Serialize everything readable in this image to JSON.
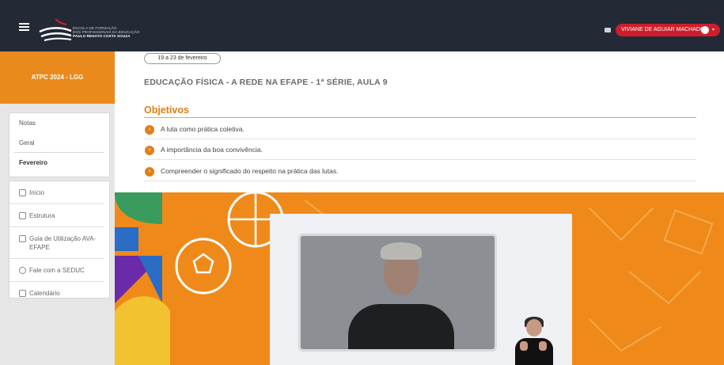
{
  "header": {
    "logo": {
      "line1": "ESCOLA DE FORMAÇÃO",
      "line2": "DOS PROFISSIONAIS DA EDUCAÇÃO",
      "line3": "PAULO RENATO COSTA SOUZA"
    },
    "user_name": "VIVIANE DE AGUIAR MACHADO"
  },
  "sidebar": {
    "course": "ATPC 2024 - LGG",
    "nav1": [
      "Notas",
      "Geral",
      "Fevereiro"
    ],
    "nav2": [
      {
        "label": "Início",
        "icon": "home-icon"
      },
      {
        "label": "Estrutura",
        "icon": "structure-icon"
      },
      {
        "label": "Guia de Utilização AVA-EFAPE",
        "icon": "book-icon"
      },
      {
        "label": "Fale com a SEDUC",
        "icon": "info-icon"
      },
      {
        "label": "Calendário",
        "icon": "calendar-icon"
      }
    ]
  },
  "main": {
    "date_range": "19 a 23 de fevereiro",
    "lesson_title": "EDUCAÇÃO FÍSICA - A REDE NA EFAPE - 1ª SÉRIE, AULA 9",
    "objectives_title": "Objetivos",
    "objectives": [
      "A luta como prática coletiva.",
      "A importância da boa convivência.",
      "Compreender o significado do respeito na prática das lutas."
    ]
  },
  "colors": {
    "topbar": "#232a36",
    "accent_orange": "#ef8a1a",
    "user_red": "#cc1f2b"
  }
}
